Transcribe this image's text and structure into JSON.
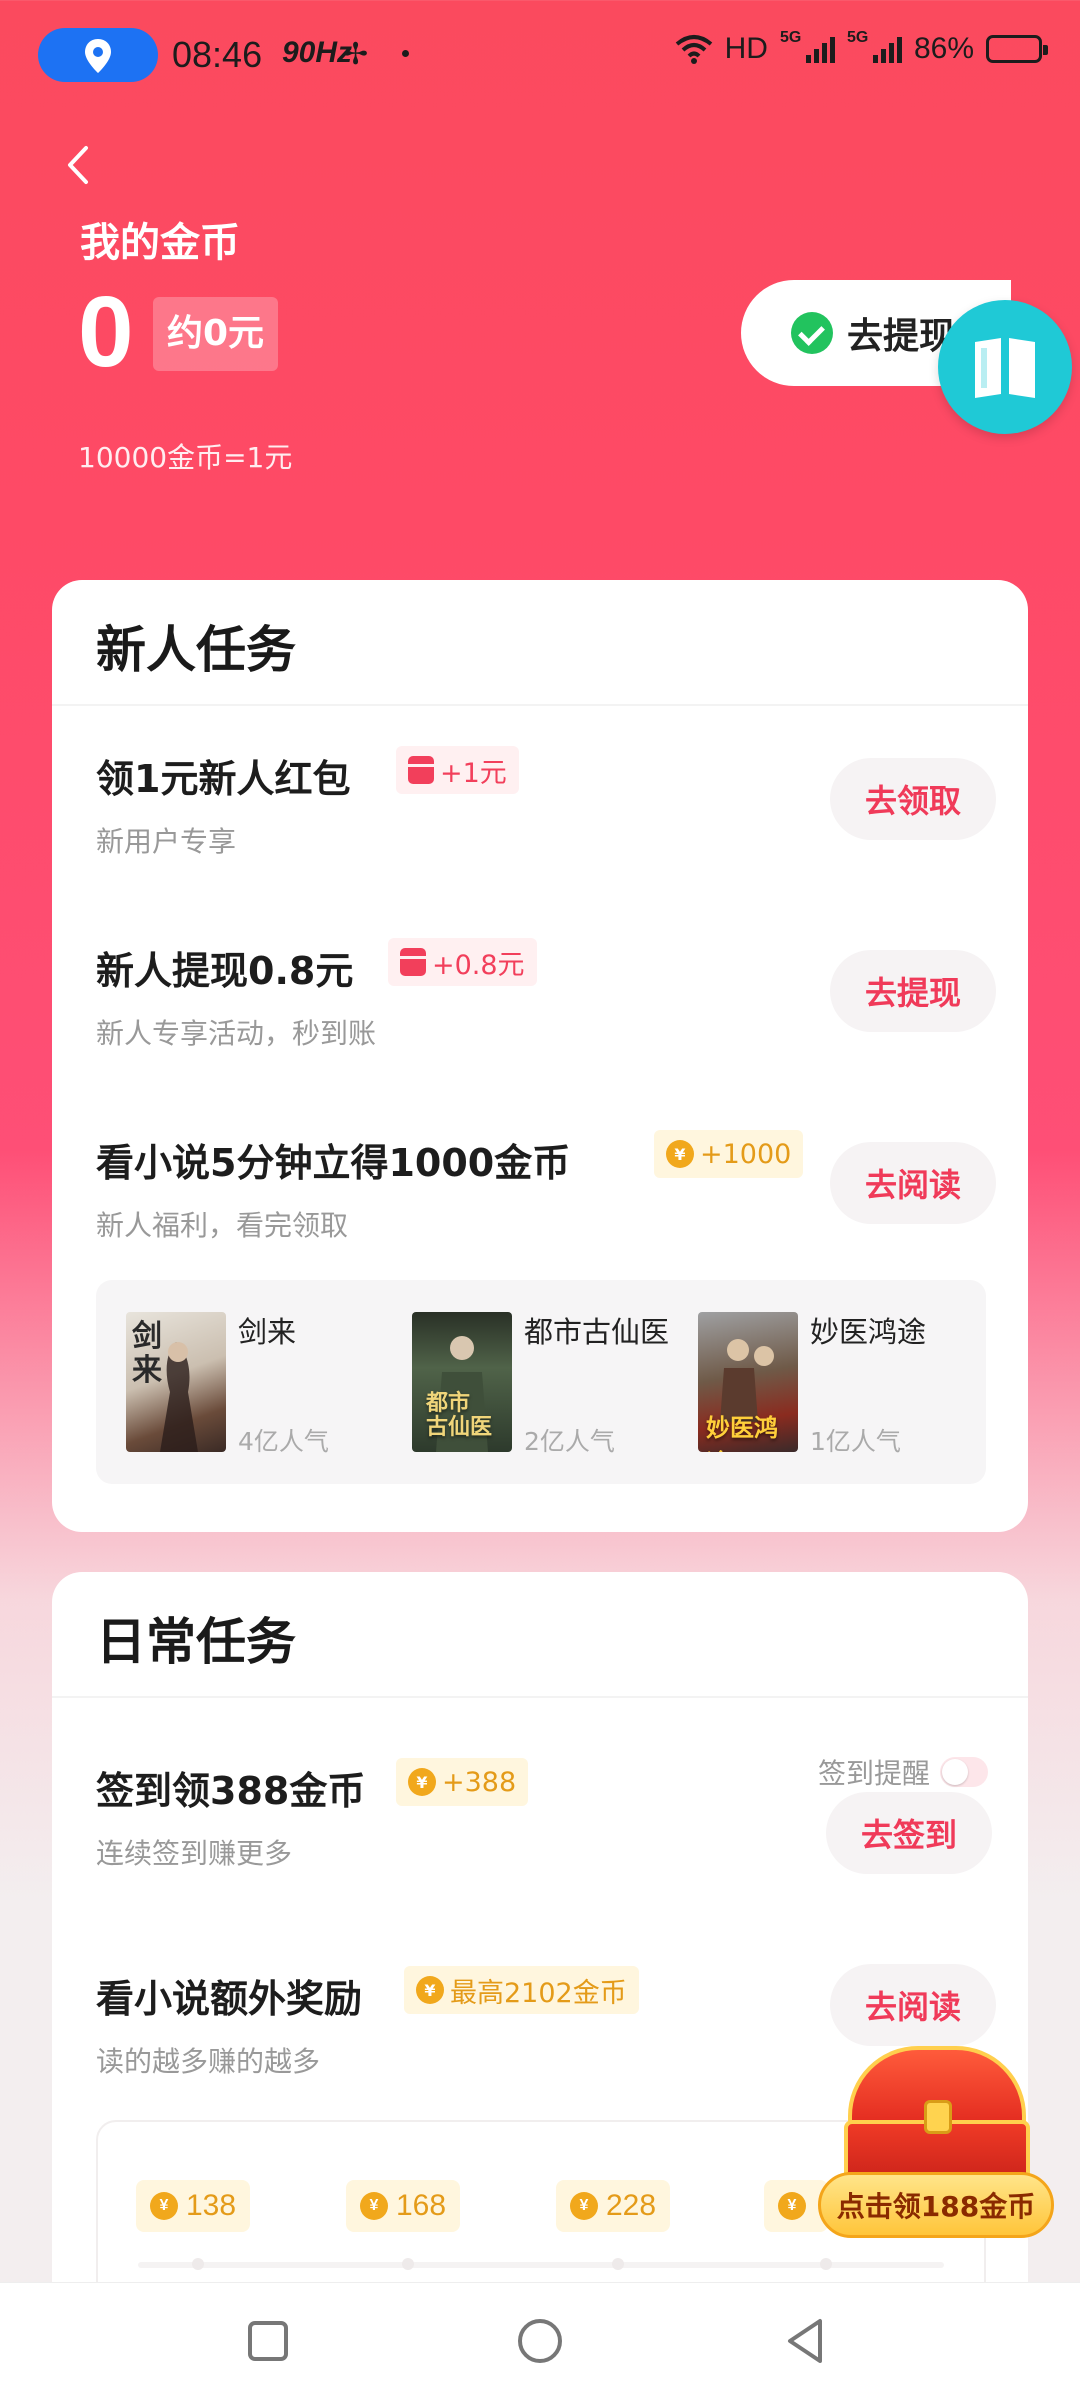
{
  "status_bar": {
    "time": "08:46",
    "refresh_rate": "90Hz",
    "network": "HD",
    "signal1": "5G",
    "signal2": "5G",
    "battery": "86%"
  },
  "header": {
    "title": "我的金币",
    "coin_amount": "0",
    "rmb_estimate": "约0元",
    "exchange_rate": "10000金币=1元",
    "withdraw_button": "去提现"
  },
  "new_user_tasks": {
    "title": "新人任务",
    "tasks": [
      {
        "title": "领1元新人红包",
        "reward": "+1元",
        "desc": "新用户专享",
        "button": "去领取"
      },
      {
        "title": "新人提现0.8元",
        "reward": "+0.8元",
        "desc": "新人专享活动，秒到账",
        "button": "去提现"
      },
      {
        "title": "看小说5分钟立得1000金币",
        "reward": "+1000",
        "desc": "新人福利，看完领取",
        "button": "去阅读"
      }
    ],
    "books": [
      {
        "name": "剑来",
        "popularity": "4亿人气"
      },
      {
        "name": "都市古仙医",
        "popularity": "2亿人气"
      },
      {
        "name": "妙医鸿途",
        "popularity": "1亿人气"
      }
    ]
  },
  "daily_tasks": {
    "title": "日常任务",
    "reminder_label": "签到提醒",
    "tasks": [
      {
        "title": "签到领388金币",
        "reward": "+388",
        "desc": "连续签到赚更多",
        "button": "去签到"
      },
      {
        "title": "看小说额外奖励",
        "reward": "最高2102金币",
        "desc": "读的越多赚的越多",
        "button": "去阅读"
      }
    ],
    "steps": [
      "138",
      "168",
      "228",
      ""
    ]
  },
  "chest": {
    "label": "点击领188金币"
  },
  "colors": {
    "accent": "#f03a59",
    "gold": "#e49b19",
    "header_bg": "#fb4a5e"
  }
}
